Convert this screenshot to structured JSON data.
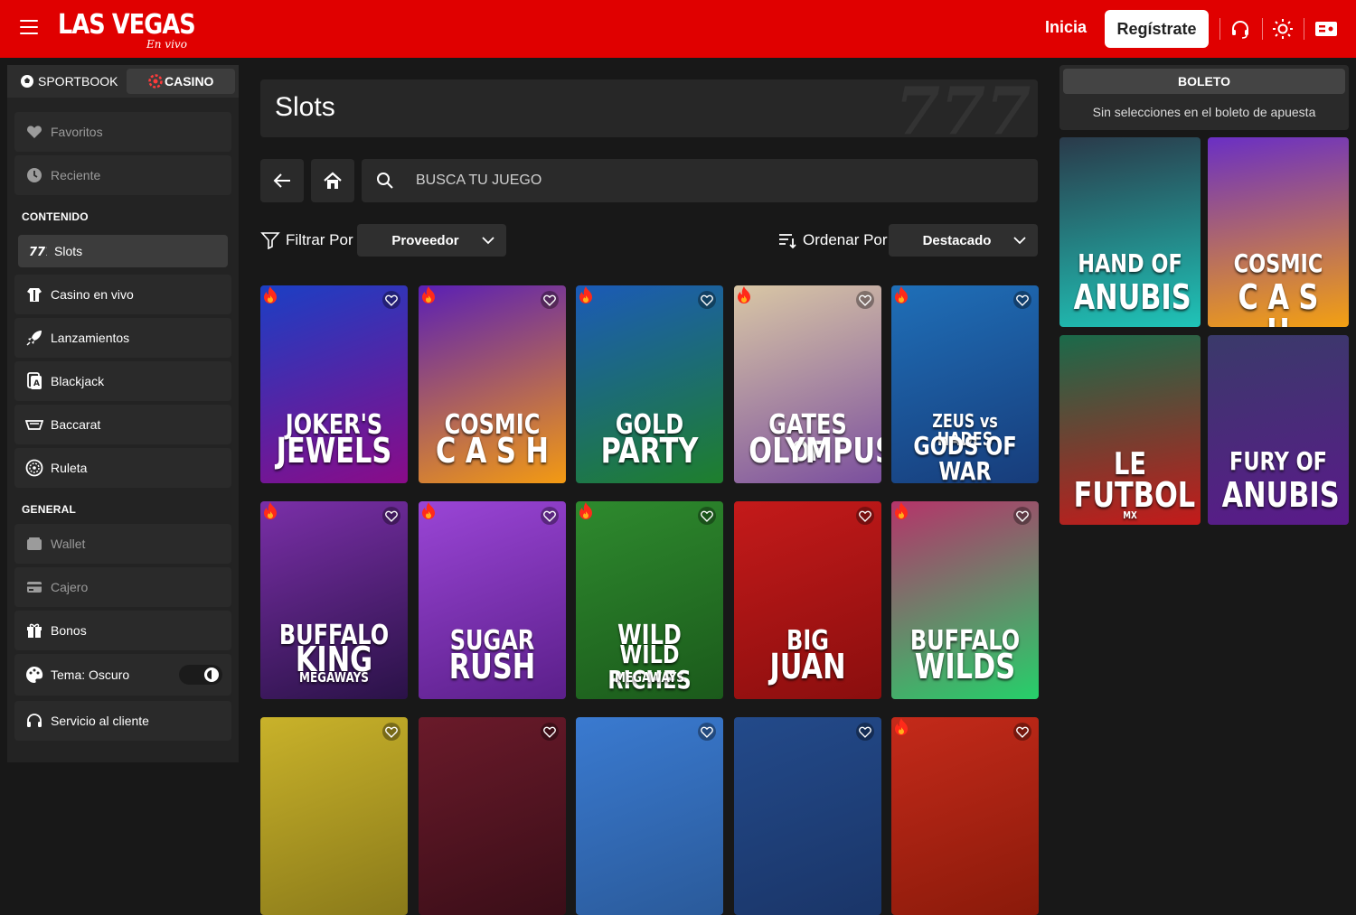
{
  "header": {
    "logo_main": "LAS VEGAS",
    "logo_sub": "En vivo",
    "login_label": "Inicia",
    "register_label": "Regístrate"
  },
  "sidebar": {
    "modes": {
      "sport": "SPORTBOOK",
      "casino": "CASINO"
    },
    "favorites": "Favoritos",
    "recent": "Reciente",
    "section_content": "CONTENIDO",
    "content_items": [
      {
        "label": "Slots",
        "icon": "slots-777-icon"
      },
      {
        "label": "Casino en vivo",
        "icon": "dealer-icon"
      },
      {
        "label": "Lanzamientos",
        "icon": "rocket-icon"
      },
      {
        "label": "Blackjack",
        "icon": "cards-icon"
      },
      {
        "label": "Baccarat",
        "icon": "baccarat-icon"
      },
      {
        "label": "Ruleta",
        "icon": "roulette-icon"
      }
    ],
    "section_general": "GENERAL",
    "general_items": [
      {
        "label": "Wallet",
        "icon": "wallet-icon"
      },
      {
        "label": "Cajero",
        "icon": "card-icon"
      },
      {
        "label": "Bonos",
        "icon": "gift-icon"
      },
      {
        "label": "Tema: Oscuro",
        "icon": "palette-icon"
      },
      {
        "label": "Servicio al cliente",
        "icon": "headset-icon"
      }
    ]
  },
  "main": {
    "title": "Slots",
    "title_deco": "777",
    "search_placeholder": "BUSCA TU JUEGO",
    "filter_label": "Filtrar Por",
    "filter_value": "Proveedor",
    "sort_label": "Ordenar Por",
    "sort_value": "Destacado",
    "games": [
      {
        "l1": "JOKER'S",
        "l2": "JEWELS",
        "c1": "#1b3fc4",
        "c2": "#8a0b88",
        "hot": true
      },
      {
        "l1": "COSMIC",
        "l2": "C A S H",
        "c1": "#5a1fb5",
        "c2": "#f39a12",
        "hot": true
      },
      {
        "l1": "GOLD",
        "l2": "PARTY",
        "c1": "#1b5ab8",
        "c2": "#1e7f2c",
        "hot": true
      },
      {
        "l1": "GATES OF",
        "l2": "OLYMPUS",
        "c1": "#d9c7a5",
        "c2": "#7b4f9e",
        "hot": true
      },
      {
        "l1": "ZEUS vs HADES",
        "l2": "GODS OF WAR",
        "c1": "#1f6fb8",
        "c2": "#173c7a",
        "hot": true
      },
      {
        "l1": "BUFFALO",
        "l2": "KING",
        "l3": "MEGAWAYS",
        "c1": "#7a2fa8",
        "c2": "#2a1247",
        "hot": true
      },
      {
        "l1": "SUGAR",
        "l2": "RUSH",
        "c1": "#9a45d6",
        "c2": "#5b1f8a",
        "hot": true
      },
      {
        "l1": "WILD",
        "l2": "WILD RICHES",
        "l3": "MEGAWAYS",
        "c1": "#2e8a2e",
        "c2": "#1b5a1b",
        "hot": true
      },
      {
        "l1": "BIG",
        "l2": "JUAN",
        "c1": "#c41a1a",
        "c2": "#8a0e0e",
        "hot": false
      },
      {
        "l1": "BUFFALO",
        "l2": "WILDS",
        "c1": "#b5346a",
        "c2": "#25d06a",
        "hot": true
      },
      {
        "l1": "",
        "l2": "",
        "c1": "#c9b22a",
        "c2": "#8a7a1a",
        "hot": false
      },
      {
        "l1": "",
        "l2": "",
        "c1": "#6a1a2a",
        "c2": "#3a0e18",
        "hot": false
      },
      {
        "l1": "",
        "l2": "",
        "c1": "#3a7ad0",
        "c2": "#2a5a9a",
        "hot": false
      },
      {
        "l1": "",
        "l2": "",
        "c1": "#234a8a",
        "c2": "#1a3568",
        "hot": false
      },
      {
        "l1": "",
        "l2": "",
        "c1": "#c42a1a",
        "c2": "#8a1a0a",
        "hot": true
      }
    ]
  },
  "betslip": {
    "tab": "BOLETO",
    "empty": "Sin selecciones en el boleto de apuesta",
    "promos": [
      {
        "l1": "HAND OF",
        "l2": "ANUBIS",
        "c1": "#2a3a4a",
        "c2": "#1fc4b8"
      },
      {
        "l1": "COSMIC",
        "l2": "C A S H",
        "c1": "#6a2fc4",
        "c2": "#f3a012"
      },
      {
        "l1": "LE",
        "l2": "FUTBOL",
        "l3": "MX",
        "c1": "#1a6a4a",
        "c2": "#c41a1a"
      },
      {
        "l1": "FURY OF",
        "l2": "ANUBIS",
        "c1": "#3a3a6a",
        "c2": "#5a1a8a"
      }
    ]
  },
  "colors": {
    "brand": "#e00000",
    "bg": "#181818",
    "panel": "#232323"
  }
}
